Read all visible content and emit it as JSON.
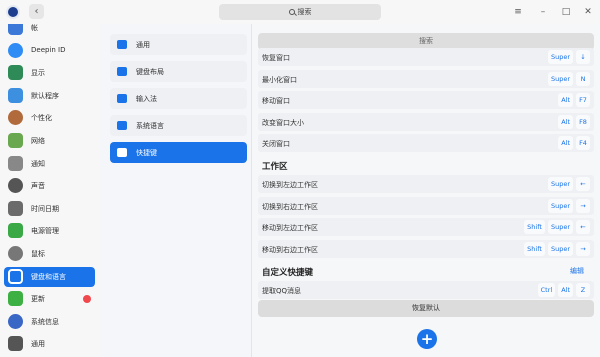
{
  "titlebar": {
    "back_glyph": "‹",
    "search_label": "搜索",
    "menu_glyph": "≡",
    "minimize_glyph": "–",
    "maximize_glyph": "□",
    "close_glyph": "✕"
  },
  "sidebar": {
    "items": [
      {
        "label": "帐",
        "icon": "account-icon",
        "color": "#3c78d8"
      },
      {
        "label": "Deepin ID",
        "icon": "cloud-icon",
        "color": "#2f8cf5"
      },
      {
        "label": "显示",
        "icon": "display-icon",
        "color": "#2e8b57"
      },
      {
        "label": "默认程序",
        "icon": "default-apps-icon",
        "color": "#3d8fe0"
      },
      {
        "label": "个性化",
        "icon": "personalization-icon",
        "color": "#b06a3b"
      },
      {
        "label": "网络",
        "icon": "network-icon",
        "color": "#6aa84f"
      },
      {
        "label": "通知",
        "icon": "bell-icon",
        "color": "#888888"
      },
      {
        "label": "声音",
        "icon": "speaker-icon",
        "color": "#555555"
      },
      {
        "label": "时间日期",
        "icon": "clock-icon",
        "color": "#6b6b6b"
      },
      {
        "label": "电源管理",
        "icon": "battery-icon",
        "color": "#3aa845"
      },
      {
        "label": "鼠标",
        "icon": "mouse-icon",
        "color": "#777777"
      },
      {
        "label": "键盘和语言",
        "icon": "keyboard-icon",
        "color": "#ffffff"
      },
      {
        "label": "更新",
        "icon": "update-icon",
        "color": "#3cb043"
      },
      {
        "label": "系统信息",
        "icon": "system-info-icon",
        "color": "#3967c5"
      },
      {
        "label": "通用",
        "icon": "general-icon",
        "color": "#555555"
      }
    ],
    "active_index": 11,
    "notify_index": 12
  },
  "midlist": {
    "items": [
      {
        "label": "通用",
        "icon": "general-settings-icon",
        "color": "#1a73e8"
      },
      {
        "label": "键盘布局",
        "icon": "keyboard-layout-icon",
        "color": "#1a73e8"
      },
      {
        "label": "输入法",
        "icon": "input-method-icon",
        "color": "#1a73e8"
      },
      {
        "label": "系统语言",
        "icon": "globe-icon",
        "color": "#1a73e8"
      },
      {
        "label": "快捷键",
        "icon": "shortcut-icon",
        "color": "#ffffff"
      }
    ],
    "active_index": 4
  },
  "content": {
    "search_label": "搜索",
    "window_rows": [
      {
        "label": "恢复窗口",
        "keys": [
          "Super",
          "↓"
        ]
      },
      {
        "label": "最小化窗口",
        "keys": [
          "Super",
          "N"
        ]
      },
      {
        "label": "移动窗口",
        "keys": [
          "Alt",
          "F7"
        ]
      },
      {
        "label": "改变窗口大小",
        "keys": [
          "Alt",
          "F8"
        ]
      },
      {
        "label": "关闭窗口",
        "keys": [
          "Alt",
          "F4"
        ]
      }
    ],
    "workspace_title": "工作区",
    "workspace_rows": [
      {
        "label": "切换到左边工作区",
        "keys": [
          "Super",
          "←"
        ]
      },
      {
        "label": "切换到右边工作区",
        "keys": [
          "Super",
          "→"
        ]
      },
      {
        "label": "移动到左边工作区",
        "keys": [
          "Shift",
          "Super",
          "←"
        ]
      },
      {
        "label": "移动到右边工作区",
        "keys": [
          "Shift",
          "Super",
          "→"
        ]
      }
    ],
    "custom_title": "自定义快捷键",
    "edit_label": "编辑",
    "custom_rows": [
      {
        "label": "提取QQ消息",
        "keys": [
          "Ctrl",
          "Alt",
          "Z"
        ]
      }
    ],
    "restore_label": "恢复默认",
    "add_glyph": "+"
  },
  "colors": {
    "accent": "#1a73e8",
    "notify": "#f0484c"
  }
}
